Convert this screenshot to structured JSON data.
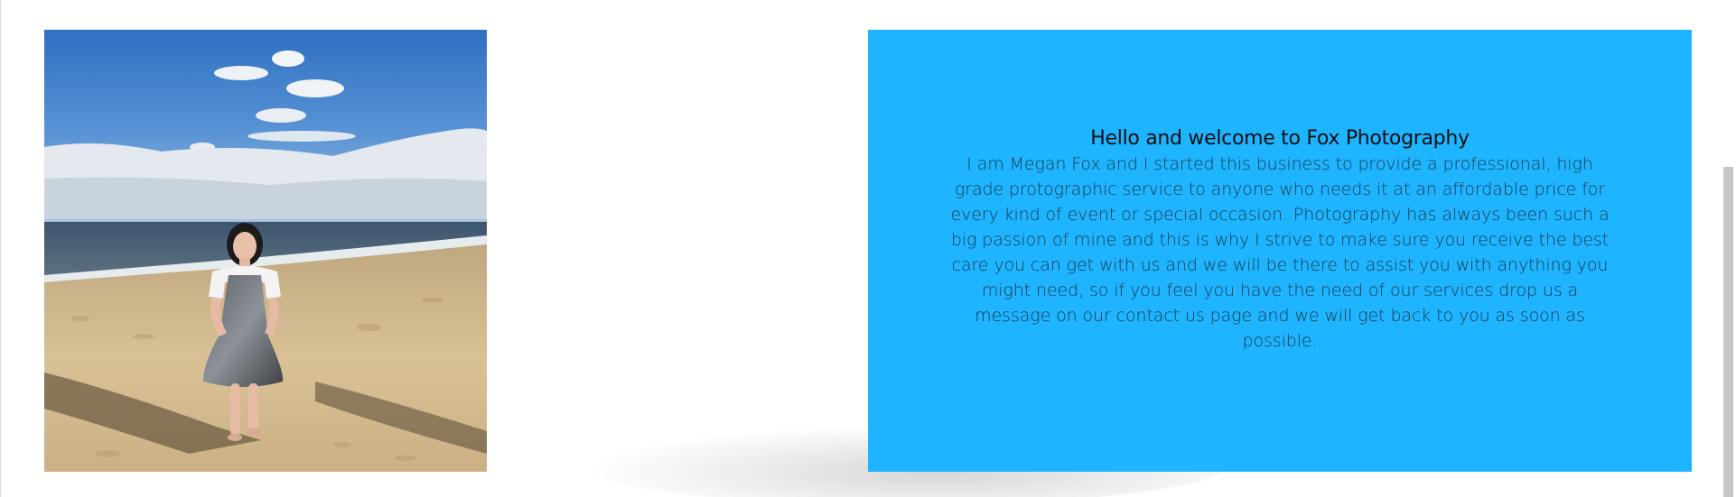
{
  "about": {
    "title": "Hello and welcome to Fox Photography",
    "body": "I am Megan Fox and I started this business to provide a professional, high grade protographic service to anyone who needs it at an affordable price for every kind of event or special occasion. Photography has always been such a big passion of mine and this is why I strive to make sure you receive the best care you can get with us and we will be there to assist you with anything you might need, so if you feel you have the need of our services drop us a message on our contact us page and we will get back to you as soon as possible."
  },
  "photo": {
    "subject": "woman-on-beach-photo"
  },
  "colors": {
    "panel": "#1EB4FF",
    "title_text": "#0f0f0f",
    "body_text": "#1a3a4a",
    "background": "#ffffff",
    "scrollbar_thumb": "#c6c6c6"
  }
}
